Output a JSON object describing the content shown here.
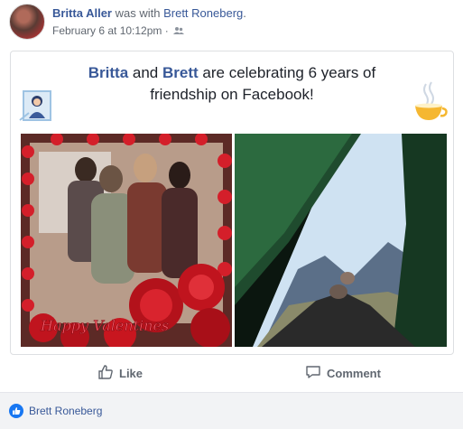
{
  "post": {
    "author": "Britta Aller",
    "was_with": "was with",
    "tagged": "Brett Roneberg",
    "tagged_suffix": ".",
    "timestamp": "February 6 at 10:12pm",
    "separator": "·",
    "audience_icon": "friends-icon"
  },
  "card": {
    "name1": "Britta",
    "and": "and",
    "name2": "Brett",
    "line1_rest": "are celebrating 6 years of",
    "line2": "friendship on Facebook!",
    "left_illustration": "framed-portrait-illustration",
    "right_illustration": "teacup-illustration",
    "photos": [
      {
        "name": "group-photo-valentine-frame",
        "frame_text": "Happy Valentines"
      },
      {
        "name": "tent-mountain-view-photo"
      }
    ]
  },
  "actions": {
    "like_label": "Like",
    "comment_label": "Comment",
    "like_icon": "thumbs-up-icon",
    "comment_icon": "comment-icon"
  },
  "reactions": {
    "icon": "like-reaction-icon",
    "names": "Brett Roneberg"
  },
  "colors": {
    "link": "#385898",
    "meta": "#606770",
    "text": "#1d2129",
    "like_blue": "#1877f2",
    "footer_bg": "#f2f3f5"
  }
}
